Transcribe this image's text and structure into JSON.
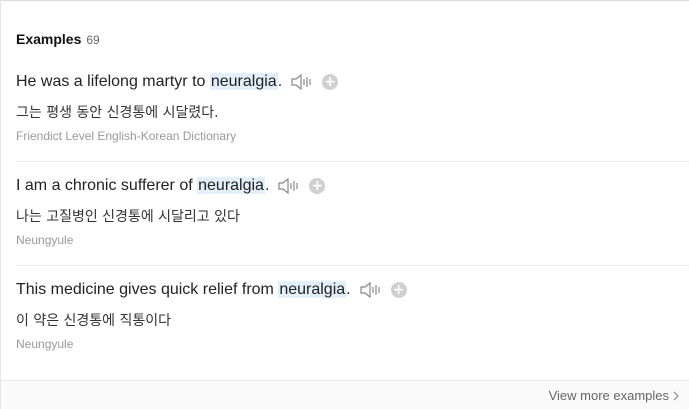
{
  "section": {
    "title": "Examples",
    "count": "69"
  },
  "examples": [
    {
      "before": "He was a lifelong martyr to ",
      "keyword": "neuralgia",
      "after": ".",
      "translation": "그는 평생 동안 신경통에 시달렸다.",
      "source": "Friendict Level English-Korean Dictionary"
    },
    {
      "before": "I am a chronic sufferer of ",
      "keyword": "neuralgia",
      "after": ".",
      "translation": "나는 고질병인 신경통에 시달리고 있다",
      "source": "Neungyule"
    },
    {
      "before": "This medicine gives quick relief from ",
      "keyword": "neuralgia",
      "after": ".",
      "translation": "이 약은 신경통에 직통이다",
      "source": "Neungyule"
    }
  ],
  "icons": {
    "audio": "speaker-icon",
    "add": "plus-icon",
    "more": "chevron-right-icon"
  },
  "add_symbol": "+",
  "footer": {
    "more_label": "View more examples"
  },
  "colors": {
    "highlight": "#e3effb",
    "add_button": "#d0d0d0",
    "source_text": "#999999"
  }
}
